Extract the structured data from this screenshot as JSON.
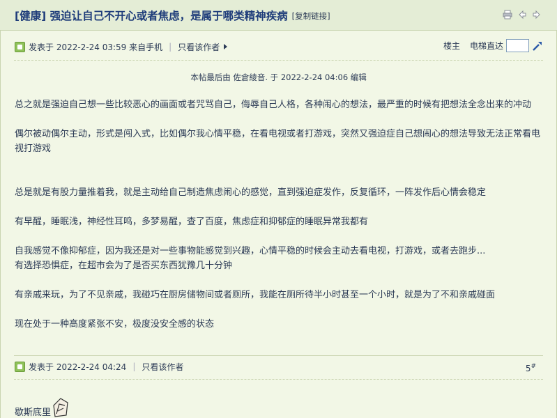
{
  "thread": {
    "title": "[健康] 强迫让自己不开心或者焦虑，是属于哪类精神疾病",
    "copy_link": "[复制链接]"
  },
  "toolbar_icons": [
    "print-icon",
    "prev-icon",
    "next-icon"
  ],
  "post1": {
    "posted_label": "发表于 2022-2-24 03:59 来自手机",
    "only_author": "只看该作者",
    "floor_label": "楼主",
    "jump_label": "电梯直达",
    "edit_note": "本帖最后由 佐倉綾音. 于 2022-2-24 04:06 编辑",
    "paragraphs": [
      "总之就是强迫自己想一些比较恶心的画面或者咒骂自己，侮辱自己人格，各种闹心的想法，最严重的时候有把想法全念出来的冲动",
      "偶尔被动偶尔主动，形式是闯入式，比如偶尔我心情平稳，在看电视或者打游戏，突然又强迫症自己想闹心的想法导致无法正常看电视打游戏",
      "总是就是有股力量推着我，就是主动给自己制造焦虑闹心的感觉，直到强迫症发作，反复循环，一阵发作后心情会稳定",
      "有早醒，睡眠浅，神经性耳鸣，多梦易醒，查了百度，焦虑症和抑郁症的睡眠异常我都有",
      "自我感觉不像抑郁症，因为我还是对一些事物能感觉到兴趣，心情平稳的时候会主动去看电视，打游戏，或者去跑步...",
      "有选择恐惧症，在超市会为了是否买东西犹豫几十分钟",
      "有亲戚来玩，为了不见亲戚，我碰巧在厨房储物间或者厕所，我能在厕所待半小时甚至一个小时，就是为了不和亲戚碰面",
      "现在处于一种高度紧张不安，极度没安全感的状态"
    ]
  },
  "post2": {
    "posted_label": "发表于 2022-2-24 04:24",
    "only_author": "只看该作者",
    "floor_number": "5",
    "floor_suffix": "#",
    "text": "歇斯底里"
  },
  "colors": {
    "background": "#f2f7e6",
    "title_bar": "#e4edd6",
    "title_text": "#1e3c7a",
    "body_text": "#2b3a55"
  }
}
